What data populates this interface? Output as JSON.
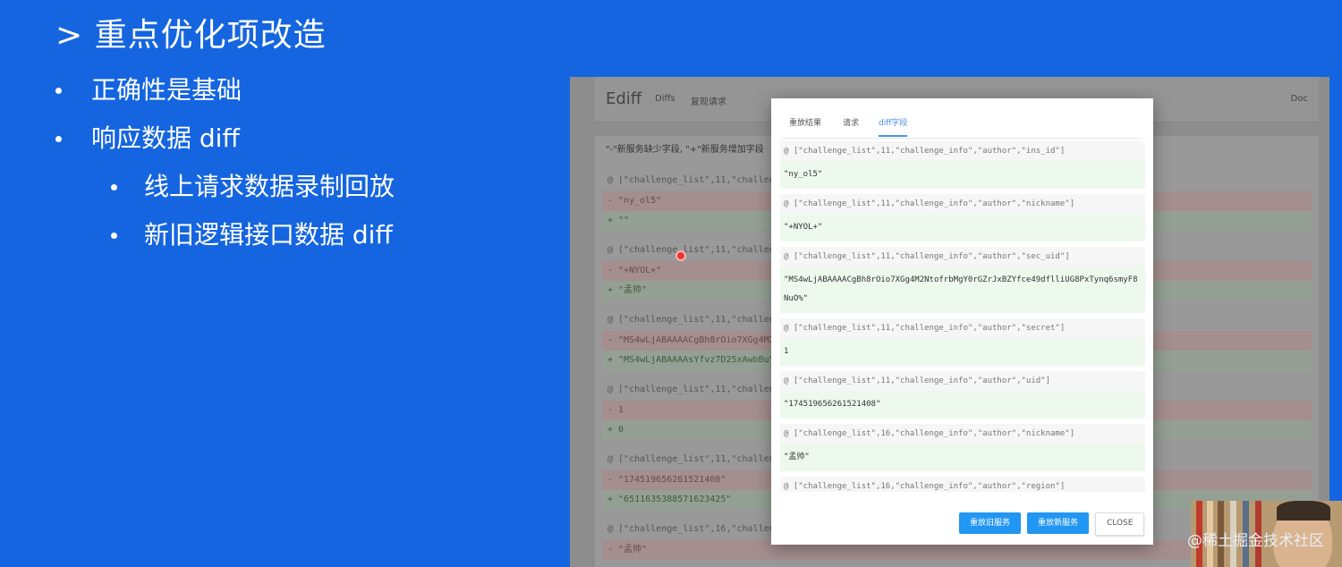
{
  "slide": {
    "title": "> 重点优化项改造",
    "bullets": [
      {
        "text": "正确性是基础",
        "level": 1
      },
      {
        "text": "响应数据 diff",
        "level": 1
      },
      {
        "text": "线上请求数据录制回放",
        "level": 2
      },
      {
        "text": "新旧逻辑接口数据 diff",
        "level": 2
      }
    ]
  },
  "app": {
    "brand": "Ediff",
    "nav": [
      "Diffs",
      "复现请求"
    ],
    "doc": "Doc",
    "legend": "\"-\"新服务缺少字段, \"+\"新服务增加字段"
  },
  "background_diffs": [
    {
      "path": "@ [\"challenge_list\",11,\"challenge_",
      "minus": "- \"ny_ol5\"",
      "plus": "+ \"\""
    },
    {
      "path": "@ [\"challenge_list\",11,\"challenge_",
      "minus": "- \"+NYOL+\"",
      "plus": "+ \"孟帅\""
    },
    {
      "path": "@ [\"challenge_list\",11,\"challenge_",
      "minus": "- \"MS4wLjABAAAACgBh8rOio7XGg4M2N\"",
      "plus": "+ \"MS4wLjABAAAAsYfvz7D25xAwbBuY0\""
    },
    {
      "path": "@ [\"challenge_list\",11,\"challenge_",
      "minus": "- 1",
      "plus": "+ 0"
    },
    {
      "path": "@ [\"challenge_list\",11,\"challenge_",
      "minus": "- \"174519656261521408\"",
      "plus": "+ \"6511635388571623425\""
    },
    {
      "path": "@ [\"challenge_list\",16,\"challenge_",
      "minus": "- \"孟帅\"",
      "plus": ""
    }
  ],
  "modal": {
    "tabs": [
      {
        "label": "重放结果",
        "active": false
      },
      {
        "label": "请求",
        "active": false
      },
      {
        "label": "diff字段",
        "active": true
      }
    ],
    "entries": [
      {
        "path": "@ [\"challenge_list\",11,\"challenge_info\",\"author\",\"ins_id\"]",
        "value": "\"ny_ol5\""
      },
      {
        "path": "@ [\"challenge_list\",11,\"challenge_info\",\"author\",\"nickname\"]",
        "value": "\"+NYOL+\""
      },
      {
        "path": "@ [\"challenge_list\",11,\"challenge_info\",\"author\",\"sec_uid\"]",
        "value": "\"MS4wLjABAAAACgBh8rOio7XGg4M2NtofrbMgY0rGZrJxBZYfce49dflliUG8PxTynq6smyF8NuO%\""
      },
      {
        "path": "@ [\"challenge_list\",11,\"challenge_info\",\"author\",\"secret\"]",
        "value": "1"
      },
      {
        "path": "@ [\"challenge_list\",11,\"challenge_info\",\"author\",\"uid\"]",
        "value": "\"174519656261521408\""
      },
      {
        "path": "@ [\"challenge_list\",16,\"challenge_info\",\"author\",\"nickname\"]",
        "value": "\"孟帅\""
      },
      {
        "path": "@ [\"challenge_list\",16,\"challenge_info\",\"author\",\"region\"]",
        "value": ""
      }
    ],
    "buttons": {
      "replay_old": "重放旧服务",
      "replay_new": "重放新服务",
      "close": "CLOSE"
    }
  },
  "watermark": "@稀土掘金技术社区",
  "colors": {
    "slide_bg": "#1565e0",
    "accent": "#2196f3",
    "tab_active": "#4a90e2"
  }
}
